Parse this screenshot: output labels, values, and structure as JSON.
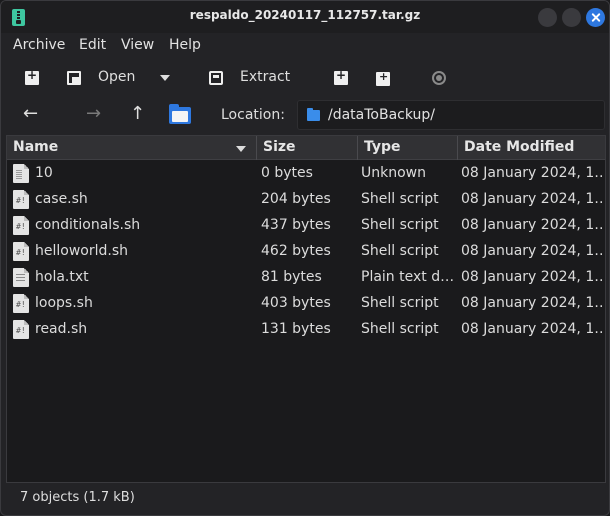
{
  "window": {
    "title": "respaldo_20240117_112757.tar.gz"
  },
  "menubar": {
    "items": [
      "Archive",
      "Edit",
      "View",
      "Help"
    ]
  },
  "toolbar": {
    "open_label": "Open",
    "extract_label": "Extract"
  },
  "location": {
    "label": "Location:",
    "path": "/dataToBackup/"
  },
  "columns": [
    "Name",
    "Size",
    "Type",
    "Date Modified"
  ],
  "files": [
    {
      "name": "10",
      "size": "0 bytes",
      "type": "Unknown",
      "date": "08 January 2024, 1…",
      "icon": "unknown-file-icon"
    },
    {
      "name": "case.sh",
      "size": "204 bytes",
      "type": "Shell script",
      "date": "08 January 2024, 1…",
      "icon": "shell-script-icon"
    },
    {
      "name": "conditionals.sh",
      "size": "437 bytes",
      "type": "Shell script",
      "date": "08 January 2024, 1…",
      "icon": "shell-script-icon"
    },
    {
      "name": "helloworld.sh",
      "size": "462 bytes",
      "type": "Shell script",
      "date": "08 January 2024, 1…",
      "icon": "shell-script-icon"
    },
    {
      "name": "hola.txt",
      "size": "81 bytes",
      "type": "Plain text d…",
      "date": "08 January 2024, 1…",
      "icon": "text-file-icon"
    },
    {
      "name": "loops.sh",
      "size": "403 bytes",
      "type": "Shell script",
      "date": "08 January 2024, 1…",
      "icon": "shell-script-icon"
    },
    {
      "name": "read.sh",
      "size": "131 bytes",
      "type": "Shell script",
      "date": "08 January 2024, 1…",
      "icon": "shell-script-icon"
    }
  ],
  "status": {
    "text": "7 objects (1.7 kB)"
  },
  "colors": {
    "accent": "#2e78e0",
    "background": "#232326",
    "list_background": "#1a1a1c"
  }
}
